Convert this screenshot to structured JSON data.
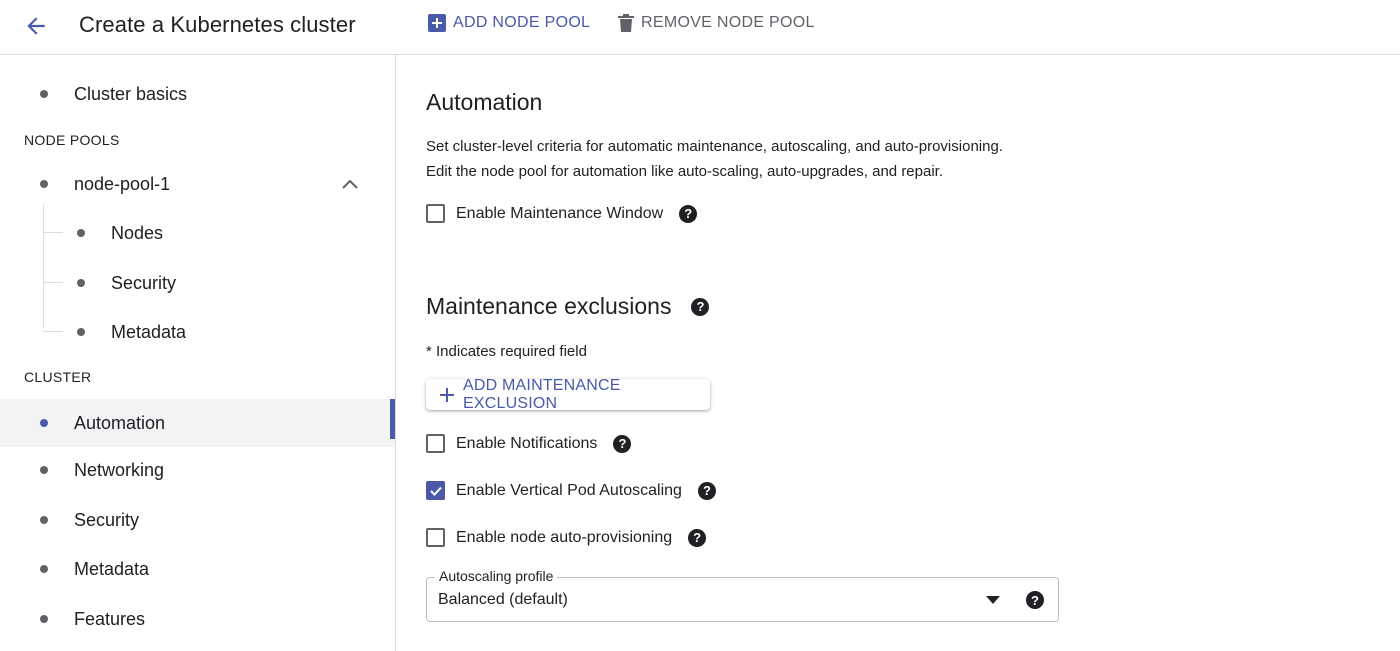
{
  "header": {
    "title": "Create a Kubernetes cluster",
    "back_icon": "arrow-back-icon",
    "add_node_pool": "ADD NODE POOL",
    "remove_node_pool": "REMOVE NODE POOL"
  },
  "sidebar": {
    "cluster_basics": "Cluster basics",
    "node_pools_header": "NODE POOLS",
    "node_pool_name": "node-pool-1",
    "node_pool_children": [
      "Nodes",
      "Security",
      "Metadata"
    ],
    "cluster_header": "CLUSTER",
    "cluster_items": [
      "Automation",
      "Networking",
      "Security",
      "Metadata",
      "Features"
    ],
    "active_item": "Automation"
  },
  "main": {
    "automation_title": "Automation",
    "automation_desc_1": "Set cluster-level criteria for automatic maintenance, autoscaling, and auto-provisioning.",
    "automation_desc_2": "Edit the node pool for automation like auto-scaling, auto-upgrades, and repair.",
    "maintenance_window_label": "Enable Maintenance Window",
    "exclusions_title": "Maintenance exclusions",
    "required_note": "* Indicates required field",
    "add_exclusion_label": "ADD MAINTENANCE EXCLUSION",
    "notifications_label": "Enable Notifications",
    "vpa_label": "Enable Vertical Pod Autoscaling",
    "nap_label": "Enable node auto-provisioning",
    "autoscaling_profile_label": "Autoscaling profile",
    "autoscaling_profile_value": "Balanced (default)",
    "help_glyph": "?"
  },
  "state": {
    "maintenance_window_checked": false,
    "notifications_checked": false,
    "vpa_checked": true,
    "nap_checked": false
  },
  "colors": {
    "accent": "#4a5aa8",
    "text": "#202124",
    "muted": "#5f6368",
    "divider": "#dadce0"
  }
}
